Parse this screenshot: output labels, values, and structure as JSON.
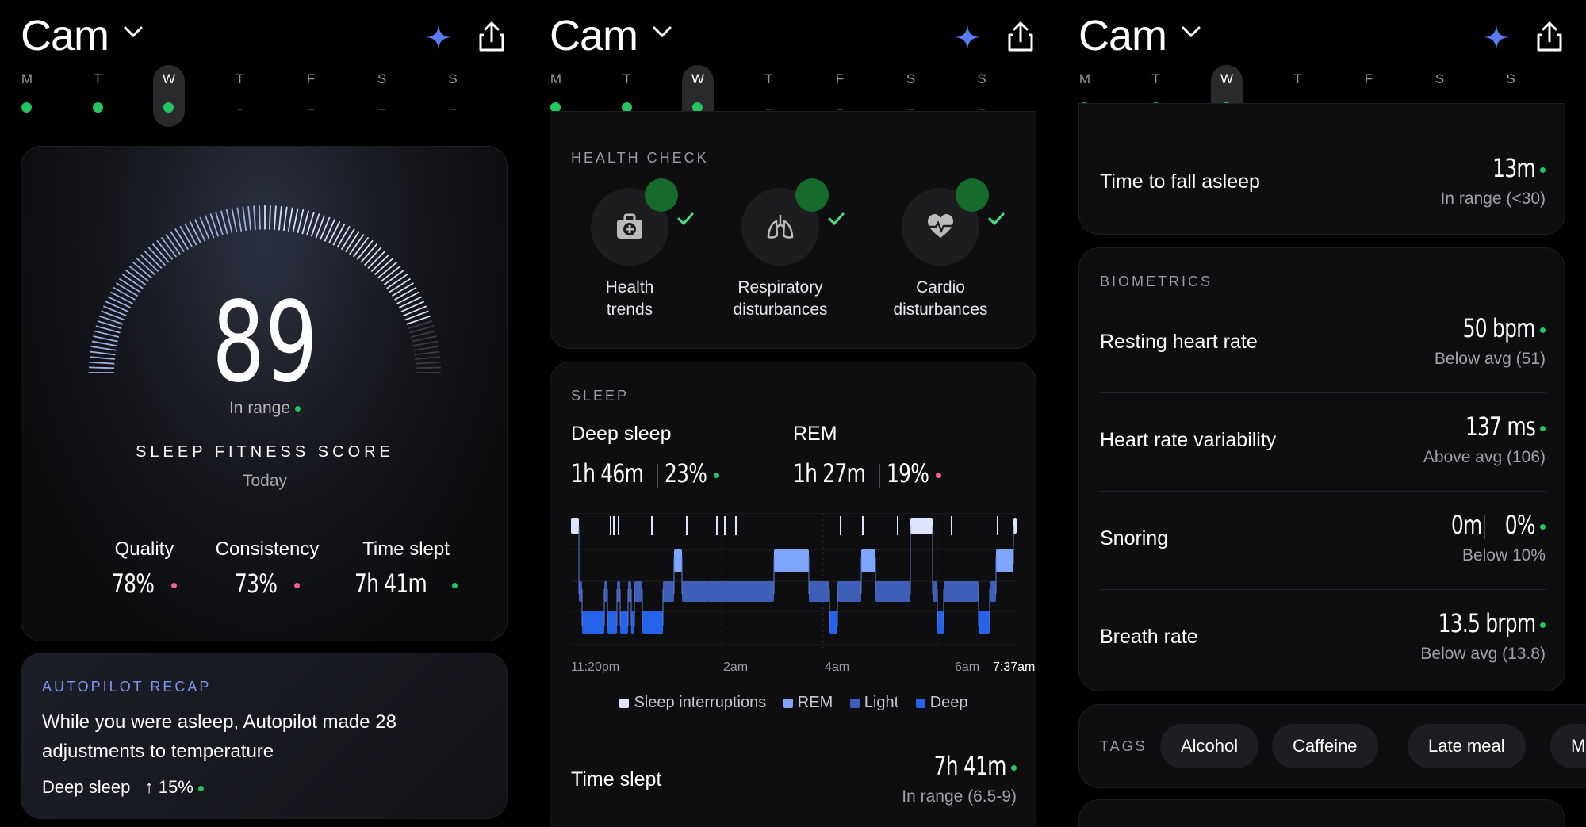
{
  "user": "Cam",
  "days": [
    "M",
    "T",
    "W",
    "T",
    "F",
    "S",
    "S"
  ],
  "selected_day": 2,
  "colors": {
    "green": "#22c55e",
    "pink": "#f06292",
    "accent": "#7e94f0",
    "sparkle": "#5b7cf5"
  },
  "panel1": {
    "score": "89",
    "score_status": "In range",
    "score_title": "SLEEP FITNESS SCORE",
    "score_date": "Today",
    "metrics": [
      {
        "label": "Quality",
        "value": "78%",
        "status": "pink"
      },
      {
        "label": "Consistency",
        "value": "73%",
        "status": "pink"
      },
      {
        "label": "Time slept",
        "value": "7h 41m",
        "status": "green"
      }
    ],
    "recap": {
      "caption": "AUTOPILOT RECAP",
      "text": "While you were asleep, Autopilot made 28 adjustments to temperature",
      "metric_label": "Deep sleep",
      "metric_value": "↑ 15%"
    }
  },
  "panel2": {
    "health_caption": "HEALTH CHECK",
    "health_items": [
      {
        "icon": "medical-kit-icon",
        "label1": "Health",
        "label2": "trends"
      },
      {
        "icon": "lungs-icon",
        "label1": "Respiratory",
        "label2": "disturbances"
      },
      {
        "icon": "heart-pulse-icon",
        "label1": "Cardio",
        "label2": "disturbances"
      }
    ],
    "sleep_caption": "SLEEP",
    "deep": {
      "label": "Deep sleep",
      "time": "1h 46m",
      "pct": "23%"
    },
    "rem": {
      "label": "REM",
      "time": "1h 27m",
      "pct": "19%"
    },
    "time_labels": [
      "11:20pm",
      "2am",
      "4am",
      "6am",
      "7:37am"
    ],
    "legend": [
      "Sleep interruptions",
      "REM",
      "Light",
      "Deep"
    ],
    "time_slept_label": "Time slept",
    "time_slept_value": "7h 41m",
    "time_slept_sub": "In range (6.5-9)"
  },
  "panel3": {
    "fall_asleep": {
      "label": "Time to fall asleep",
      "value": "13m",
      "sub": "In range (<30)"
    },
    "bio_caption": "BIOMETRICS",
    "biometrics": [
      {
        "label": "Resting heart rate",
        "value": "50 bpm",
        "sub": "Below avg (51)"
      },
      {
        "label": "Heart rate variability",
        "value": "137 ms",
        "sub": "Above avg (106)"
      },
      {
        "label": "Snoring",
        "value": "0m",
        "value2": "0%",
        "sub": "Below 10%"
      },
      {
        "label": "Breath rate",
        "value": "13.5 brpm",
        "sub": "Below avg (13.8)"
      }
    ],
    "tags_caption": "TAGS",
    "tags": [
      "Alcohol",
      "Caffeine",
      "Late meal",
      "Me"
    ]
  }
}
